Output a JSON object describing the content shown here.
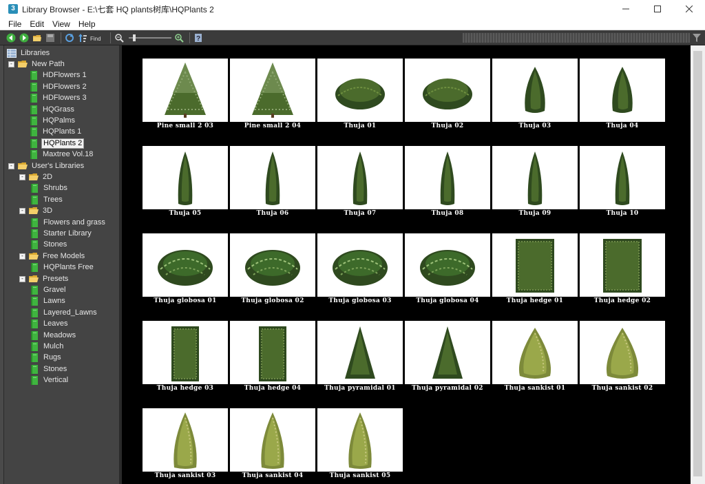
{
  "window": {
    "title": "Library Browser - E:\\七套 HQ plants树库\\HQPlants 2",
    "app_icon": "3"
  },
  "menu": [
    "File",
    "Edit",
    "View",
    "Help"
  ],
  "toolbar": {
    "icons": [
      "back-icon",
      "forward-icon",
      "open-folder-icon",
      "save-icon",
      "refresh-icon",
      "sort-icon",
      "find-icon",
      "zoom-out-icon",
      "zoom-in-icon",
      "help-icon"
    ],
    "find_label": "Find"
  },
  "tree": [
    {
      "label": "Libraries",
      "level": 0,
      "icon": "library-root",
      "toggle": "",
      "selected": false
    },
    {
      "label": "New Path",
      "level": 1,
      "icon": "folder",
      "toggle": "-",
      "selected": false
    },
    {
      "label": "HDFlowers 1",
      "level": 2,
      "icon": "library-book",
      "toggle": "",
      "selected": false
    },
    {
      "label": "HDFlowers 2",
      "level": 2,
      "icon": "library-book",
      "toggle": "",
      "selected": false
    },
    {
      "label": "HDFlowers 3",
      "level": 2,
      "icon": "library-book",
      "toggle": "",
      "selected": false
    },
    {
      "label": "HQGrass",
      "level": 2,
      "icon": "library-book",
      "toggle": "",
      "selected": false
    },
    {
      "label": "HQPalms",
      "level": 2,
      "icon": "library-book",
      "toggle": "",
      "selected": false
    },
    {
      "label": "HQPlants 1",
      "level": 2,
      "icon": "library-book",
      "toggle": "",
      "selected": false
    },
    {
      "label": "HQPlants 2",
      "level": 2,
      "icon": "library-book",
      "toggle": "",
      "selected": true
    },
    {
      "label": "Maxtree Vol.18",
      "level": 2,
      "icon": "library-book",
      "toggle": "",
      "selected": false
    },
    {
      "label": "User's Libraries",
      "level": 1,
      "icon": "folder",
      "toggle": "-",
      "selected": false
    },
    {
      "label": "2D",
      "level": 2,
      "icon": "folder",
      "toggle": "-",
      "selected": false
    },
    {
      "label": "Shrubs",
      "level": 3,
      "icon": "library-book",
      "toggle": "",
      "selected": false
    },
    {
      "label": "Trees",
      "level": 3,
      "icon": "library-book",
      "toggle": "",
      "selected": false
    },
    {
      "label": "3D",
      "level": 2,
      "icon": "folder",
      "toggle": "-",
      "selected": false
    },
    {
      "label": "Flowers and grass",
      "level": 3,
      "icon": "library-book",
      "toggle": "",
      "selected": false
    },
    {
      "label": "Starter Library",
      "level": 3,
      "icon": "library-book",
      "toggle": "",
      "selected": false
    },
    {
      "label": "Stones",
      "level": 3,
      "icon": "library-book",
      "toggle": "",
      "selected": false
    },
    {
      "label": "Free Models",
      "level": 2,
      "icon": "folder",
      "toggle": "-",
      "selected": false
    },
    {
      "label": "HQPlants Free",
      "level": 3,
      "icon": "library-book",
      "toggle": "",
      "selected": false
    },
    {
      "label": "Presets",
      "level": 2,
      "icon": "folder",
      "toggle": "-",
      "selected": false
    },
    {
      "label": "Gravel",
      "level": 3,
      "icon": "library-book",
      "toggle": "",
      "selected": false
    },
    {
      "label": "Lawns",
      "level": 3,
      "icon": "library-book",
      "toggle": "",
      "selected": false
    },
    {
      "label": "Layered_Lawns",
      "level": 3,
      "icon": "library-book",
      "toggle": "",
      "selected": false
    },
    {
      "label": "Leaves",
      "level": 3,
      "icon": "library-book",
      "toggle": "",
      "selected": false
    },
    {
      "label": "Meadows",
      "level": 3,
      "icon": "library-book",
      "toggle": "",
      "selected": false
    },
    {
      "label": "Mulch",
      "level": 3,
      "icon": "library-book",
      "toggle": "",
      "selected": false
    },
    {
      "label": "Rugs",
      "level": 3,
      "icon": "library-book",
      "toggle": "",
      "selected": false
    },
    {
      "label": "Stones",
      "level": 3,
      "icon": "library-book",
      "toggle": "",
      "selected": false
    },
    {
      "label": "Vertical",
      "level": 3,
      "icon": "library-book",
      "toggle": "",
      "selected": false
    }
  ],
  "items": [
    {
      "label": "Pine small 2 03",
      "shape": "pine"
    },
    {
      "label": "Pine small 2 04",
      "shape": "pine"
    },
    {
      "label": "Thuja 01",
      "shape": "bush"
    },
    {
      "label": "Thuja 02",
      "shape": "bush"
    },
    {
      "label": "Thuja 03",
      "shape": "cone"
    },
    {
      "label": "Thuja 04",
      "shape": "cone"
    },
    {
      "label": "Thuja 05",
      "shape": "column"
    },
    {
      "label": "Thuja 06",
      "shape": "column"
    },
    {
      "label": "Thuja 07",
      "shape": "column"
    },
    {
      "label": "Thuja 08",
      "shape": "column"
    },
    {
      "label": "Thuja 09",
      "shape": "column"
    },
    {
      "label": "Thuja 10",
      "shape": "column"
    },
    {
      "label": "Thuja globosa 01",
      "shape": "globe"
    },
    {
      "label": "Thuja globosa 02",
      "shape": "globe"
    },
    {
      "label": "Thuja globosa 03",
      "shape": "globe"
    },
    {
      "label": "Thuja globosa 04",
      "shape": "globe"
    },
    {
      "label": "Thuja hedge 01",
      "shape": "hedge-wide"
    },
    {
      "label": "Thuja hedge 02",
      "shape": "hedge-wide"
    },
    {
      "label": "Thuja hedge 03",
      "shape": "hedge-tall"
    },
    {
      "label": "Thuja hedge 04",
      "shape": "hedge-tall"
    },
    {
      "label": "Thuja pyramidal 01",
      "shape": "pyramid"
    },
    {
      "label": "Thuja pyramidal 02",
      "shape": "pyramid"
    },
    {
      "label": "Thuja sankist 01",
      "shape": "sankist"
    },
    {
      "label": "Thuja sankist 02",
      "shape": "sankist"
    },
    {
      "label": "Thuja sankist 03",
      "shape": "sankist-tall"
    },
    {
      "label": "Thuja sankist 04",
      "shape": "sankist-tall"
    },
    {
      "label": "Thuja sankist 05",
      "shape": "sankist-tall"
    }
  ],
  "colors": {
    "panel_bg": "#444444",
    "gallery_bg": "#000000",
    "dark_green": "#2f4a1f",
    "mid_green": "#4b6b2c",
    "yellow_green": "#9aa84a"
  }
}
